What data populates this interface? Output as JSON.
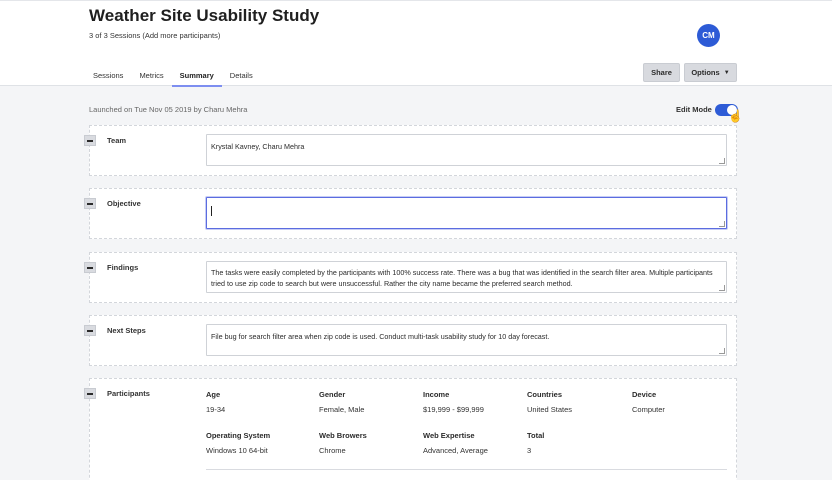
{
  "header": {
    "title": "Weather Site Usability Study",
    "sessions": "3 of 3 Sessions",
    "add_more": "(Add more participants)",
    "avatar_initials": "CM",
    "tabs": [
      {
        "label": "Sessions",
        "active": false
      },
      {
        "label": "Metrics",
        "active": false
      },
      {
        "label": "Summary",
        "active": true
      },
      {
        "label": "Details",
        "active": false
      }
    ],
    "share_label": "Share",
    "options_label": "Options"
  },
  "meta": {
    "launched": "Launched on Tue Nov 05 2019 by Charu Mehra",
    "edit_mode_label": "Edit Mode",
    "edit_mode_on": true
  },
  "sections": {
    "team": {
      "label": "Team",
      "value": "Krystal Kavney, Charu Mehra"
    },
    "objective": {
      "label": "Objective",
      "value": ""
    },
    "findings": {
      "label": "Findings",
      "value": "The tasks were easily completed by the participants with 100% success rate. There was a bug that was identified in the search filter area. Multiple participants tried to use zip code to search but were unsuccessful. Rather the city name became the preferred search method."
    },
    "next_steps": {
      "label": "Next Steps",
      "value": "File bug for search filter area when zip code is used. Conduct multi-task usability study for 10 day forecast."
    },
    "participants": {
      "label": "Participants",
      "age_label": "Age",
      "age": "19-34",
      "gender_label": "Gender",
      "gender": "Female, Male",
      "income_label": "Income",
      "income": "$19,999 - $99,999",
      "countries_label": "Countries",
      "countries": "United States",
      "device_label": "Device",
      "device": "Computer",
      "os_label": "Operating System",
      "os": "Windows 10 64-bit",
      "browsers_label": "Web Browers",
      "browsers": "Chrome",
      "expertise_label": "Web Expertise",
      "expertise": "Advanced, Average",
      "total_label": "Total",
      "total": "3"
    }
  },
  "colors": {
    "accent": "#2d5bd6",
    "tab_underline": "#7d8ef0",
    "focus": "#5b6ce0"
  },
  "icons": [
    "caret-down-icon",
    "collapse-minus-icon",
    "pointer-cursor-icon",
    "resize-grip-icon"
  ]
}
